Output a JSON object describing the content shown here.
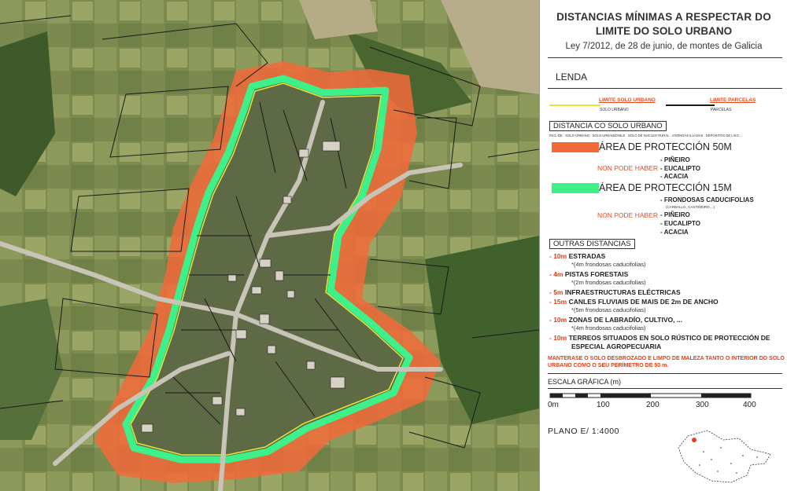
{
  "legend": {
    "title_line1": "DISTANCIAS MÍNIMAS A RESPECTAR DO",
    "title_line2": "LIMITE DO SOLO URBANO",
    "subtitle": "Ley 7/2012, de 28 de junio, de montes de Galicia",
    "lenda": "LENDA",
    "line_solo_urbano_red": "LIMITE SOLO URBANO",
    "line_solo_urbano_small": "SOLO URBANO",
    "line_parcelas_red": "LIMITE PARCELAS",
    "line_parcelas_small": "PARCELAS",
    "distancia_header": "DISTANCIA CO SOLO URBANO",
    "distancia_note": "INCL-DE : SOLO URBANO . SOLO URBANIZABLE . SOLO DE NUCLEO RURAL . VIVENDAS ILLADAS . DEPOSITOS DE LIXO ...",
    "area50": "ÁREA DE PROTECCIÓN 50M",
    "area50_nopode": "NON PODE HABER",
    "area50_items": [
      "- PIÑEIRO",
      "- EUCALIPTO",
      "- ACACIA"
    ],
    "area15": "ÁREA DE PROTECCIÓN 15M",
    "area15_item1": "- FRONDOSAS CADUCIFOLIAS",
    "area15_item1_sub": "(CARBALLO, CASTIÑEIRO,...)",
    "area15_nopode": "NON PODE HABER",
    "area15_items": [
      "- PIÑEIRO",
      "- EUCALIPTO",
      "- ACACIA"
    ],
    "outras_header": "OUTRAS DISTANCIAS",
    "distances": [
      {
        "value": "- 10m",
        "label": "ESTRADAS",
        "note": "*(4m frondosas caducifolias)"
      },
      {
        "value": "- 4m",
        "label": "PISTAS FORESTAIS",
        "note": "*(2m frondosas caducifolias)"
      },
      {
        "value": "- 5m",
        "label": "INFRAESTRUCTURAS ELÉCTRICAS",
        "note": ""
      },
      {
        "value": "- 15m",
        "label": "CANLES FLUVIAIS DE MAIS DE 2m DE ANCHO",
        "note": "*(5m frondosas caducifolias)"
      },
      {
        "value": "- 10m",
        "label": "ZONAS DE LABRADÍO, CULTIVO, ...",
        "note": "*(4m frondosas caducifolias)"
      },
      {
        "value": "- 10m",
        "label": "TERREOS SITUADOS EN SOLO RÚSTICO DE PROTECCIÓN DE",
        "label2": "ESPECIAL AGROPECUARIA",
        "note": ""
      }
    ],
    "maintenance_line1": "MANTERASE O SOLO DESBROZADO E LIMPO DE MALEZA TANTO O INTERIOR DO SOLO",
    "maintenance_line2": "URBANO COMO O SEU PERÍMETRO DE 50 m.",
    "scale_title": "ESCALA GRÁFICA (m)",
    "scale_labels": [
      "0m",
      "100",
      "200",
      "300",
      "400"
    ],
    "plano": "PLANO E/ 1:4000"
  },
  "colors": {
    "protection_50m": "#f26a3a",
    "protection_15m": "#3df08a",
    "limite_solo_urbano": "#e6e43a",
    "parcelas": "#1a1a1a",
    "accent_red": "#e0401b"
  }
}
